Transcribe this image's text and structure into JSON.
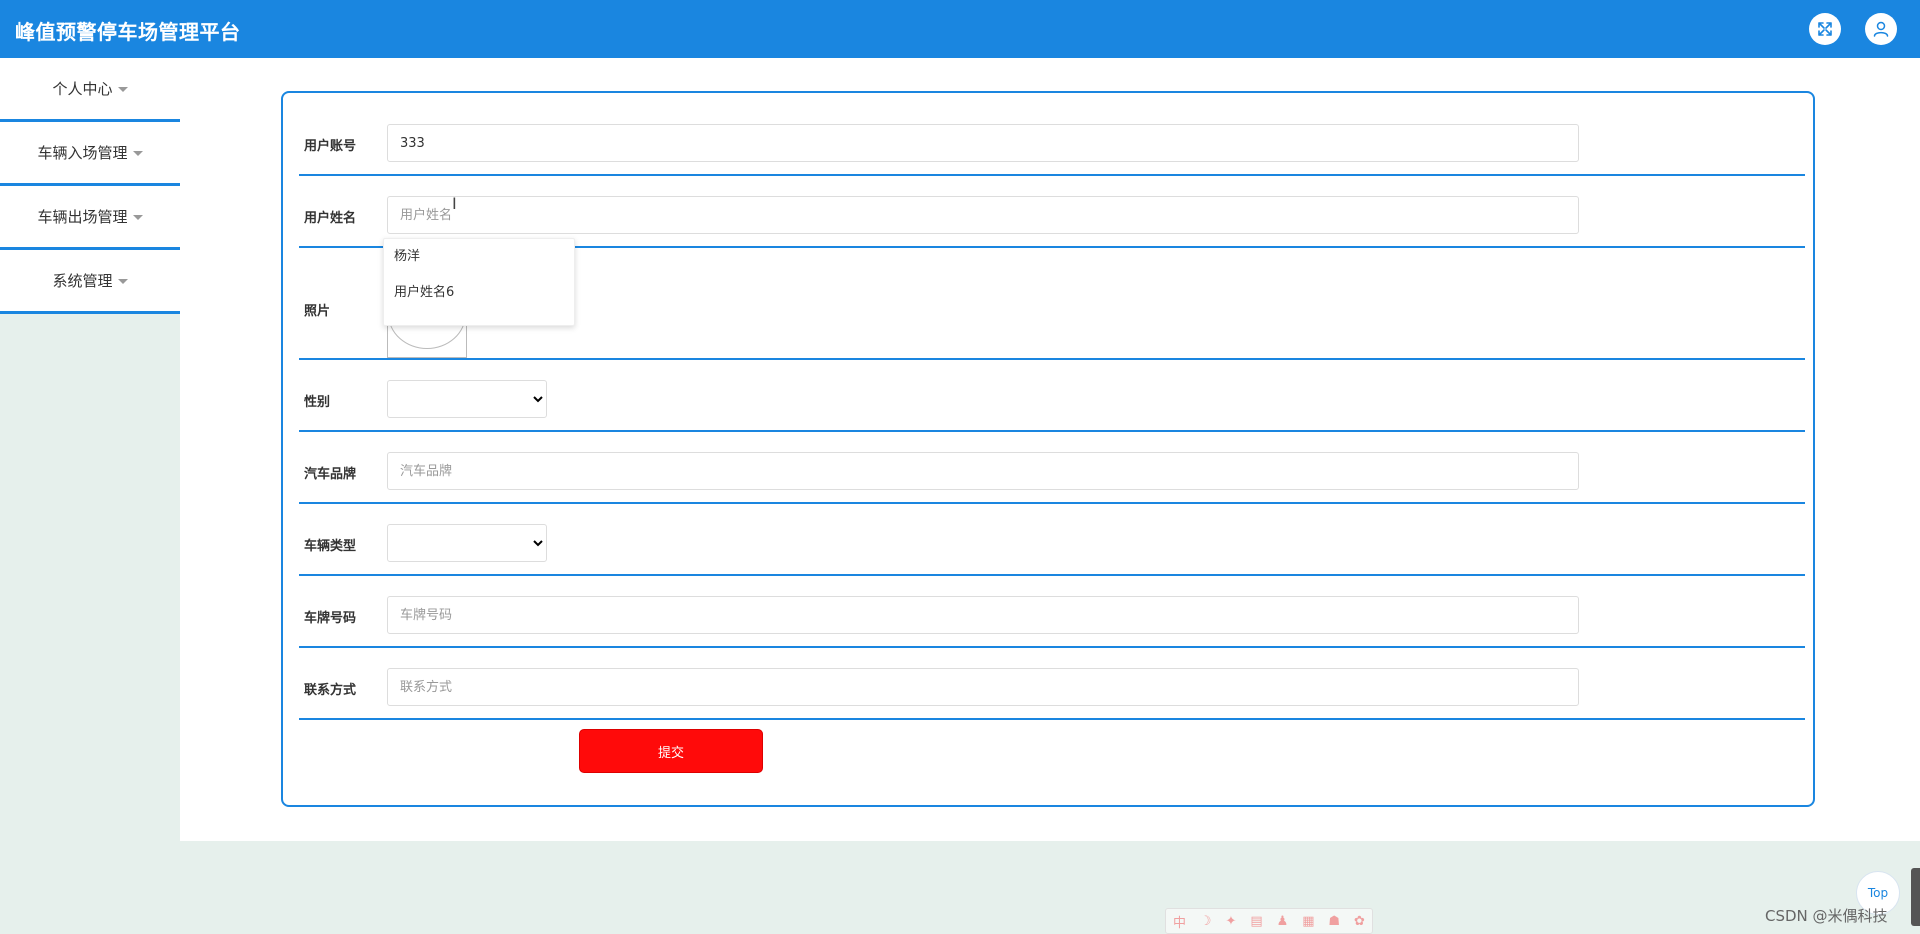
{
  "header": {
    "title": "峰值预警停车场管理平台",
    "fullscreen_icon": "fullscreen-icon",
    "user_icon": "user-icon",
    "accent_color": "#1a86e0"
  },
  "sidebar": {
    "items": [
      {
        "label": "个人中心"
      },
      {
        "label": "车辆入场管理"
      },
      {
        "label": "车辆出场管理"
      },
      {
        "label": "系统管理"
      }
    ]
  },
  "form": {
    "fields": {
      "account": {
        "label": "用户账号",
        "value": "333"
      },
      "name": {
        "label": "用户姓名",
        "placeholder": "用户姓名"
      },
      "photo": {
        "label": "照片"
      },
      "gender": {
        "label": "性别"
      },
      "car_brand": {
        "label": "汽车品牌",
        "placeholder": "汽车品牌"
      },
      "vehicle_type": {
        "label": "车辆类型"
      },
      "plate": {
        "label": "车牌号码",
        "placeholder": "车牌号码"
      },
      "contact": {
        "label": "联系方式",
        "placeholder": "联系方式"
      }
    },
    "autocomplete": [
      "杨洋",
      "用户姓名6"
    ],
    "submit_label": "提交",
    "submit_color": "#ff0a0a"
  },
  "footer": {
    "top_label": "Top",
    "watermark": "CSDN @米偶科技",
    "toolbar_glyphs": [
      "中",
      "☽",
      "✦",
      "▤",
      "♟",
      "▦",
      "☗",
      "✿"
    ]
  }
}
